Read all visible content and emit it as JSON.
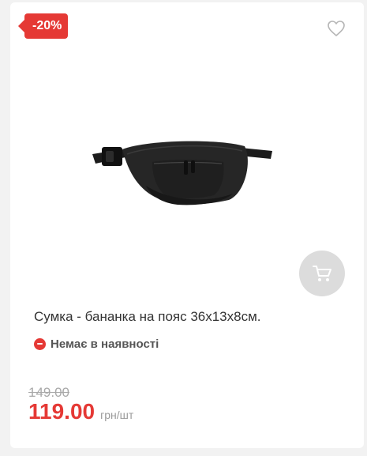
{
  "product": {
    "discount_badge": "-20%",
    "title": "Сумка - бананка на пояс 36х13х8см.",
    "availability": "Немає в наявності",
    "old_price": "149.00",
    "price": "119.00",
    "price_unit": "грн/шт"
  },
  "colors": {
    "accent": "#e53935",
    "cart_button_bg": "#dcdcdc",
    "old_price": "#a8a8a8"
  },
  "icons": {
    "wishlist": "heart-outline-icon",
    "cart": "shopping-cart-icon",
    "availability": "minus-circle-icon"
  }
}
